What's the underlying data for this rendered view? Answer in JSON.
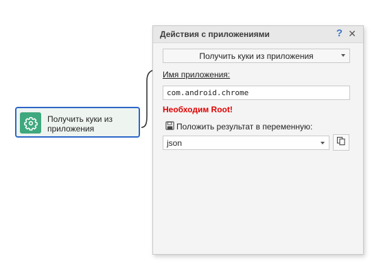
{
  "node": {
    "title": "Получить куки из приложения",
    "icon": "gear-icon",
    "accent_color": "#3fa87e",
    "border_color": "#2b66c8"
  },
  "panel": {
    "title": "Действия с приложениями",
    "help_label": "?",
    "close_label": "✕",
    "action_value": "Получить куки из приложения",
    "app_name_label": "Имя приложения:",
    "app_name_value": "com.android.chrome",
    "root_warning": "Необходим Root!",
    "root_warning_color": "#e00000",
    "save_label": "Положить результат в переменную:",
    "save_icon": "floppy-disk-icon",
    "variable_value": "json",
    "copy_icon": "copy-icon"
  }
}
